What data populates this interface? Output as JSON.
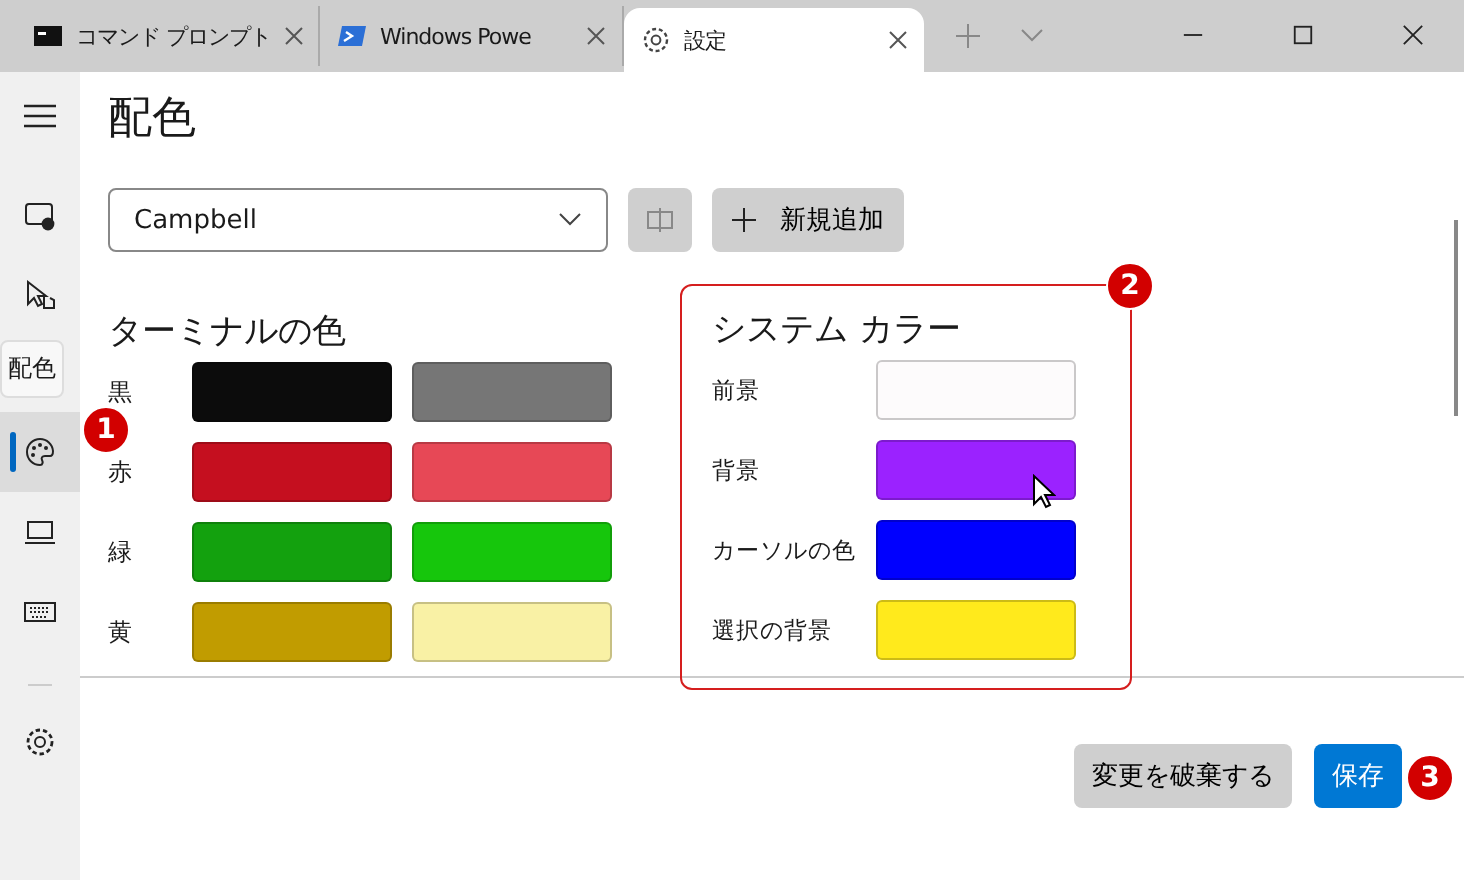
{
  "tabs": [
    {
      "label": "コマンド プロンプト",
      "kind": "cmd",
      "selected": false
    },
    {
      "label": "Windows Powe",
      "kind": "powershell",
      "selected": false
    },
    {
      "label": "設定",
      "kind": "settings",
      "selected": true
    }
  ],
  "sidebar": {
    "items": [
      {
        "kind": "startup",
        "selected": false
      },
      {
        "kind": "interaction",
        "selected": false
      },
      {
        "kind": "palette",
        "selected": true
      },
      {
        "kind": "rendering",
        "selected": false
      },
      {
        "kind": "actions",
        "selected": false
      }
    ],
    "tooltip": "配色"
  },
  "page": {
    "title": "配色",
    "scheme_dropdown": {
      "value": "Campbell"
    },
    "new_button": "新規追加"
  },
  "terminal_colors": {
    "title": "ターミナルの色",
    "rows": [
      {
        "label": "黒",
        "colors": [
          {
            "color": "#0c0c0c"
          },
          {
            "color": "#767676"
          }
        ]
      },
      {
        "label": "赤",
        "colors": [
          {
            "color": "#c50f1f"
          },
          {
            "color": "#e74856"
          }
        ]
      },
      {
        "label": "緑",
        "colors": [
          {
            "color": "#13a10e"
          },
          {
            "color": "#16c60c"
          }
        ]
      },
      {
        "label": "黄",
        "colors": [
          {
            "color": "#c19c00"
          },
          {
            "color": "#f9f1a5"
          }
        ]
      }
    ]
  },
  "system_colors": {
    "title": "システム カラー",
    "rows": [
      {
        "label": "前景",
        "color": "#fdfbfc"
      },
      {
        "label": "背景",
        "color": "#9b22ff"
      },
      {
        "label": "カーソルの色",
        "color": "#0000ff"
      },
      {
        "label": "選択の背景",
        "color": "#ffea1c"
      }
    ]
  },
  "footer": {
    "discard_button": "変更を破棄する",
    "save_button": "保存"
  },
  "callouts": [
    "1",
    "2",
    "3"
  ]
}
